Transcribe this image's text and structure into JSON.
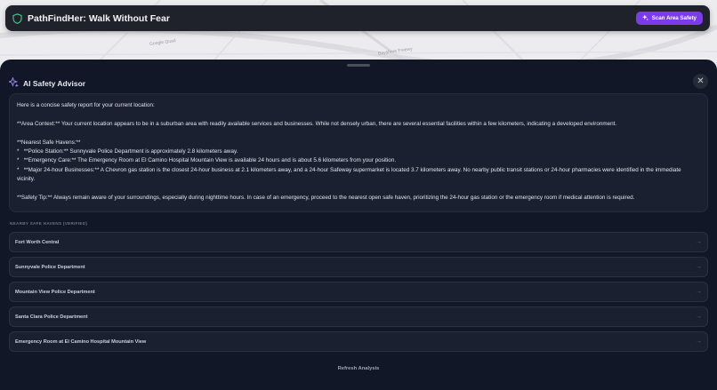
{
  "map": {
    "labels": [
      "Google Quad",
      "Bayshore Freewy"
    ]
  },
  "header": {
    "title": "PathFindHer: Walk Without Fear",
    "scan_label": "Scan Area Safety",
    "logo_icon": "shield-icon",
    "accent": "#7c3aed"
  },
  "advisor": {
    "title": "AI Safety Advisor",
    "title_icon": "sparkles-icon",
    "close_icon": "close-icon",
    "report": {
      "intro": "Here is a concise safety report for your current location:",
      "context": "**Area Context:** Your current location appears to be in a suburban area with readily available services and businesses. While not densely urban, there are several essential facilities within a few kilometers, indicating a developed environment.",
      "havens_heading": "**Nearest Safe Havens:**",
      "bullets": [
        "*   **Police Station:** Sunnyvale Police Department is approximately 2.8 kilometers away.",
        "*   **Emergency Care:** The Emergency Room at El Camino Hospital Mountain View is available 24 hours and is about 5.6 kilometers from your position.",
        "*   **Major 24-hour Businesses:** A Chevron gas station is the closest 24-hour business at 2.1 kilometers away, and a 24-hour Safeway supermarket is located 3.7 kilometers away. No nearby public transit stations or 24-hour pharmacies were identified in the immediate vicinity."
      ],
      "tip": "**Safety Tip:** Always remain aware of your surroundings, especially during nighttime hours. In case of an emergency, proceed to the nearest open safe haven, prioritizing the 24-hour gas station or the emergency room if medical attention is required."
    },
    "section_label": "NEARBY SAFE HAVENS (VERIFIED)",
    "havens": [
      "Fort Worth Central",
      "Sunnyvale Police Department",
      "Mountain View Police Department",
      "Santa Clara Police Department",
      "Emergency Room at El Camino Hospital Mountain View"
    ],
    "refresh_label": "Refresh Analysis"
  }
}
